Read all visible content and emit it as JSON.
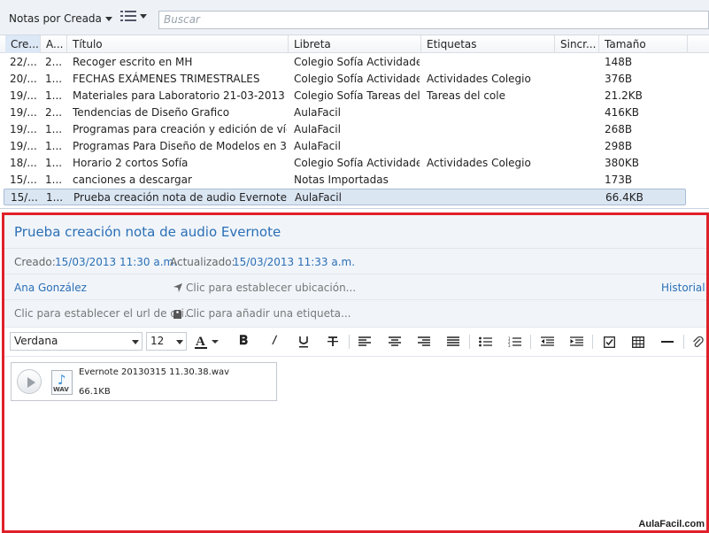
{
  "toolbar": {
    "sort_label": "Notas por Creada",
    "search_placeholder": "Buscar"
  },
  "table": {
    "columns": [
      "Cre...",
      "A...",
      "Título",
      "Libreta",
      "Etiquetas",
      "Sincr...",
      "Tamaño"
    ],
    "rows": [
      {
        "created": "22/...",
        "updated": "2...",
        "title": "Recoger escrito en MH",
        "notebook": "Colegio Sofía Actividades",
        "tags": "",
        "sync": "",
        "size": "148B"
      },
      {
        "created": "20/...",
        "updated": "1...",
        "title": "FECHAS EXÁMENES TRIMESTRALES",
        "notebook": "Colegio Sofía Actividades",
        "tags": "Actividades Colegio",
        "sync": "",
        "size": "376B"
      },
      {
        "created": "19/...",
        "updated": "1...",
        "title": "Materiales para Laboratorio 21-03-2013",
        "notebook": "Colegio Sofía Tareas del ...",
        "tags": "Tareas del cole",
        "sync": "",
        "size": "21.2KB"
      },
      {
        "created": "19/...",
        "updated": "2...",
        "title": "Tendencias de Diseño Grafico",
        "notebook": "AulaFacil",
        "tags": "",
        "sync": "",
        "size": "416KB"
      },
      {
        "created": "19/...",
        "updated": "1...",
        "title": "Programas para creación y edición de vídeos",
        "notebook": "AulaFacil",
        "tags": "",
        "sync": "",
        "size": "268B"
      },
      {
        "created": "19/...",
        "updated": "1...",
        "title": "Programas Para Diseño de Modelos en 3D",
        "notebook": "AulaFacil",
        "tags": "",
        "sync": "",
        "size": "298B"
      },
      {
        "created": "18/...",
        "updated": "1...",
        "title": "Horario 2 cortos Sofía",
        "notebook": "Colegio Sofía Actividades",
        "tags": "Actividades Colegio",
        "sync": "",
        "size": "380KB"
      },
      {
        "created": "15/...",
        "updated": "1...",
        "title": "canciones a descargar",
        "notebook": "Notas Importadas",
        "tags": "",
        "sync": "",
        "size": "173B"
      },
      {
        "created": "15/...",
        "updated": "1...",
        "title": "Prueba creación nota de audio Evernote",
        "notebook": "AulaFacil",
        "tags": "",
        "sync": "",
        "size": "66.4KB"
      }
    ]
  },
  "note": {
    "title": "Prueba creación nota de audio Evernote",
    "created_label": "Creado:",
    "created_value": "15/03/2013 11:30 a.m.",
    "updated_label": "Actualizado:",
    "updated_value": "15/03/2013 11:33 a.m.",
    "author": "Ana González",
    "location_hint": "Clic para establecer ubicación...",
    "history_link": "Historial d",
    "url_hint": "Clic para establecer el url de ori...",
    "tag_hint": "Clic para añadir una etiqueta..."
  },
  "format": {
    "font": "Verdana",
    "size": "12"
  },
  "attachment": {
    "name": "Evernote 20130315 11.30.38.wav",
    "size": "66.1KB",
    "icon_label": "WAV"
  },
  "watermark": "AulaFacil.com",
  "colors": {
    "accent": "#2b6fb5",
    "panel_border": "#e0202a",
    "selection": "#dbe6f3"
  }
}
